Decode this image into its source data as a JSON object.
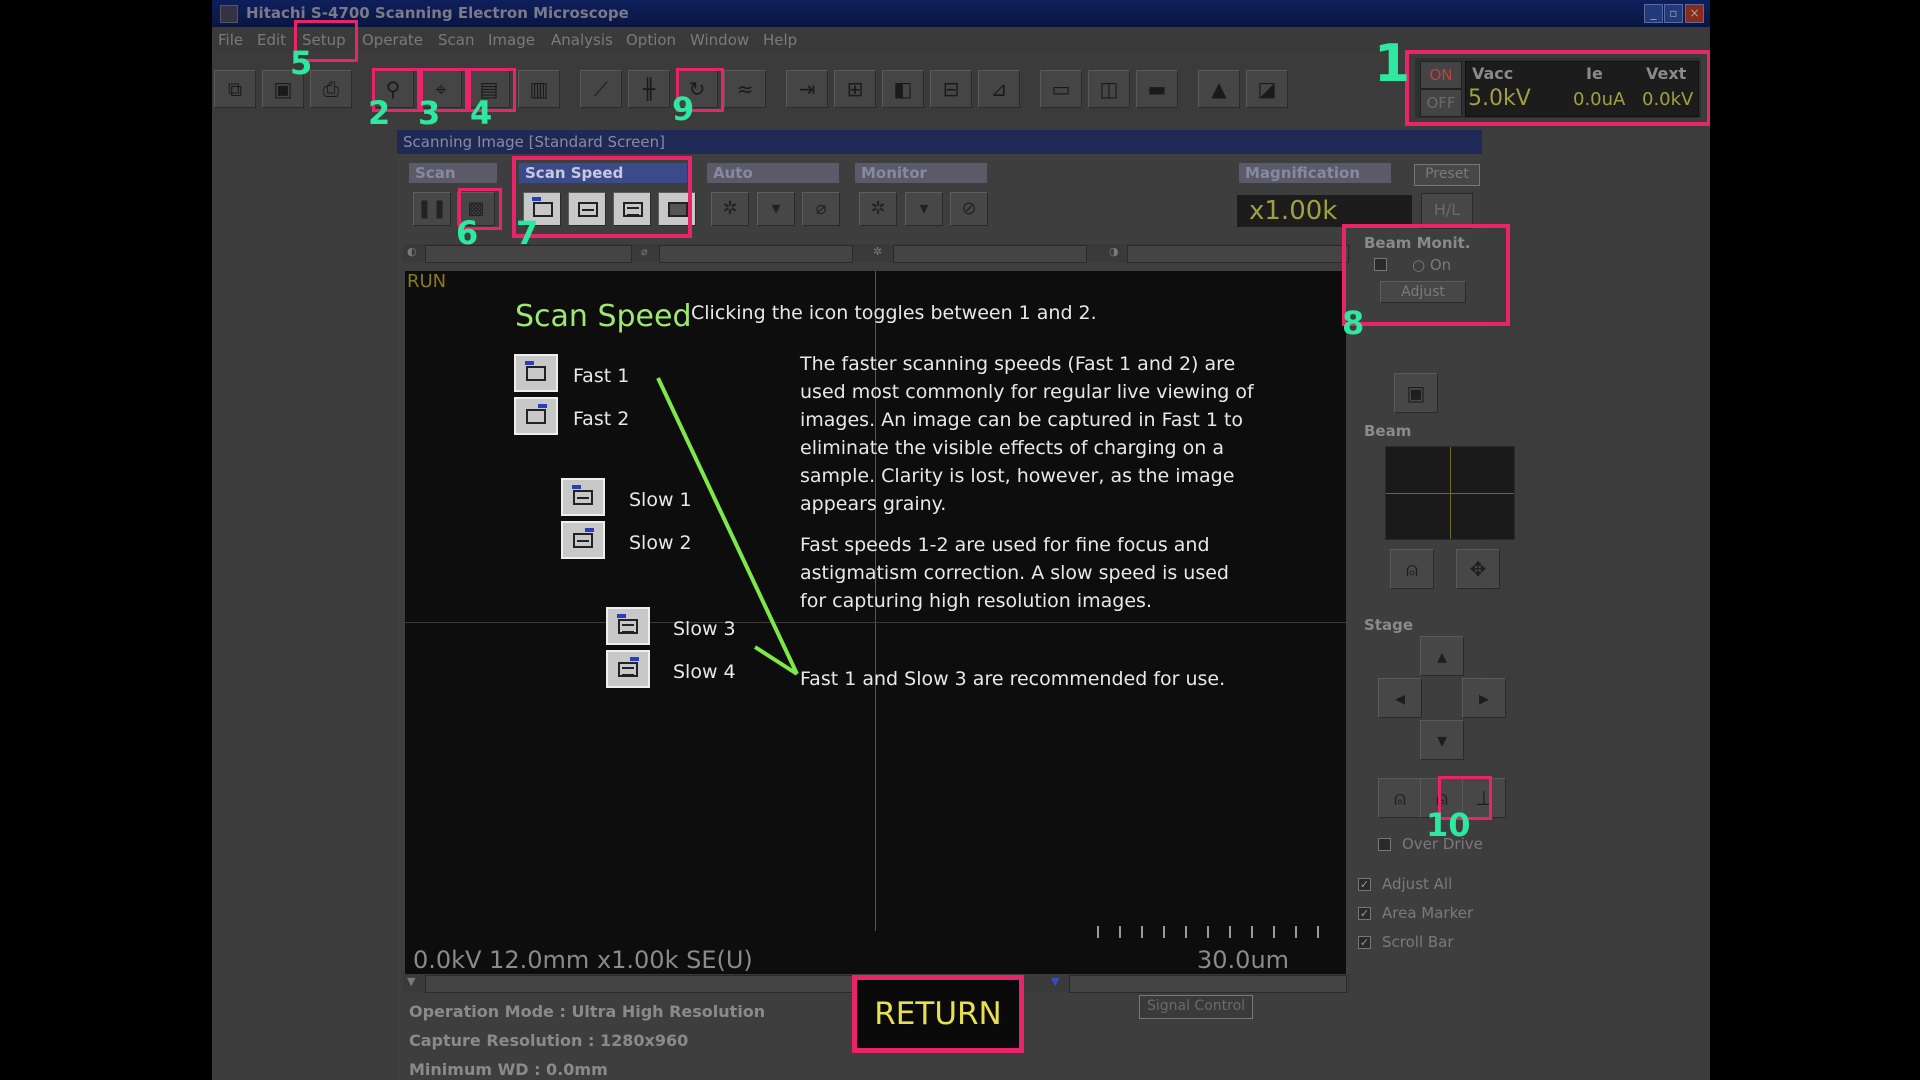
{
  "window": {
    "title": "Hitachi S-4700 Scanning Electron Microscope"
  },
  "menu": {
    "items": [
      "File",
      "Edit",
      "Setup",
      "Operate",
      "Scan",
      "Image",
      "Analysis",
      "Option",
      "Window",
      "Help"
    ]
  },
  "status": {
    "on": "ON",
    "off": "OFF",
    "vacc_label": "Vacc",
    "ie_label": "Ie",
    "vext_label": "Vext",
    "vacc": "5.0kV",
    "ie": "0.0uA",
    "vext": "0.0kV"
  },
  "inner": {
    "title": "Scanning Image [Standard Screen]",
    "groups": {
      "scan": "Scan",
      "scan_speed": "Scan Speed",
      "auto": "Auto",
      "monitor": "Monitor",
      "magnification": "Magnification"
    },
    "preset": "Preset",
    "magnification_value": "x1.00k",
    "hl": "H/L",
    "run": "RUN",
    "bottom_info": "0.0kV 12.0mm x1.00k SE(U)",
    "scale": "30.0um",
    "operation_mode": "Operation Mode : Ultra High Resolution",
    "capture_resolution": "Capture Resolution : 1280x960",
    "minimum_wd": "Minimum WD : 0.0mm",
    "signal_control": "Signal Control"
  },
  "right_panel": {
    "beam_monit": "Beam Monit.",
    "on": "On",
    "adjust": "Adjust",
    "beam": "Beam",
    "stage": "Stage",
    "over_drive": "Over Drive",
    "adjust_all": "Adjust All",
    "area_marker": "Area Marker",
    "scroll_bar": "Scroll Bar"
  },
  "overlay": {
    "title": "Scan Speed",
    "toggle_note": "Clicking the icon toggles between 1 and 2.",
    "speeds": [
      "Fast 1",
      "Fast 2",
      "Slow 1",
      "Slow 2",
      "Slow 3",
      "Slow 4"
    ],
    "para1": [
      "The faster scanning speeds (Fast 1 and 2) are",
      "used most commonly for regular live viewing of",
      "images. An image can be captured in Fast 1 to",
      "eliminate the visible effects of charging on a",
      "sample. Clarity is lost, however, as the image",
      "appears grainy."
    ],
    "para2": [
      "Fast speeds 1-2 are used for fine focus and",
      "astigmatism correction. A slow speed is used",
      "for capturing high resolution images."
    ],
    "recommend": "Fast 1 and Slow 3 are recommended for use."
  },
  "callouts": [
    "1",
    "2",
    "3",
    "4",
    "5",
    "6",
    "7",
    "8",
    "9",
    "10"
  ],
  "return_button": "RETURN",
  "colors": {
    "highlight": "#e8246a",
    "callout": "#2ee8a0",
    "title_green": "#9fe870",
    "arrow": "#7ee84a",
    "return_text": "#e8e050"
  }
}
